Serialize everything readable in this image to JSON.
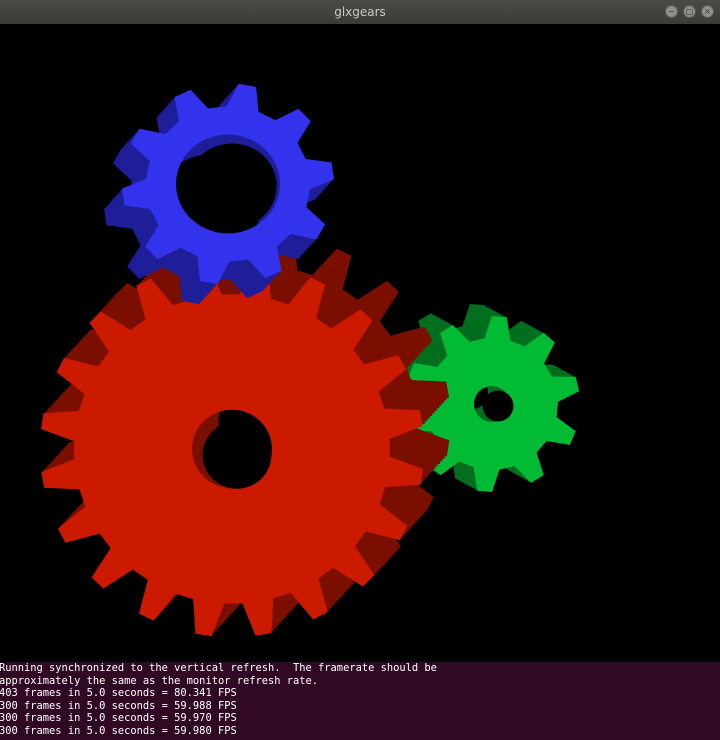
{
  "window": {
    "title": "glxgears",
    "controls": {
      "minimize_icon": "−",
      "maximize_icon": "□",
      "close_icon": "×"
    }
  },
  "scene": {
    "background": "#000000",
    "gears": [
      {
        "name": "red",
        "face_color": "#cc1a00",
        "side_color": "#7a0f00"
      },
      {
        "name": "blue",
        "face_color": "#3333ee",
        "side_color": "#1e1e99"
      },
      {
        "name": "green",
        "face_color": "#00bb33",
        "side_color": "#006e1e"
      }
    ]
  },
  "terminal": {
    "background": "#300a24",
    "lines": [
      "Running synchronized to the vertical refresh.  The framerate should be",
      "approximately the same as the monitor refresh rate.",
      "403 frames in 5.0 seconds = 80.341 FPS",
      "300 frames in 5.0 seconds = 59.988 FPS",
      "300 frames in 5.0 seconds = 59.970 FPS",
      "300 frames in 5.0 seconds = 59.980 FPS"
    ]
  }
}
